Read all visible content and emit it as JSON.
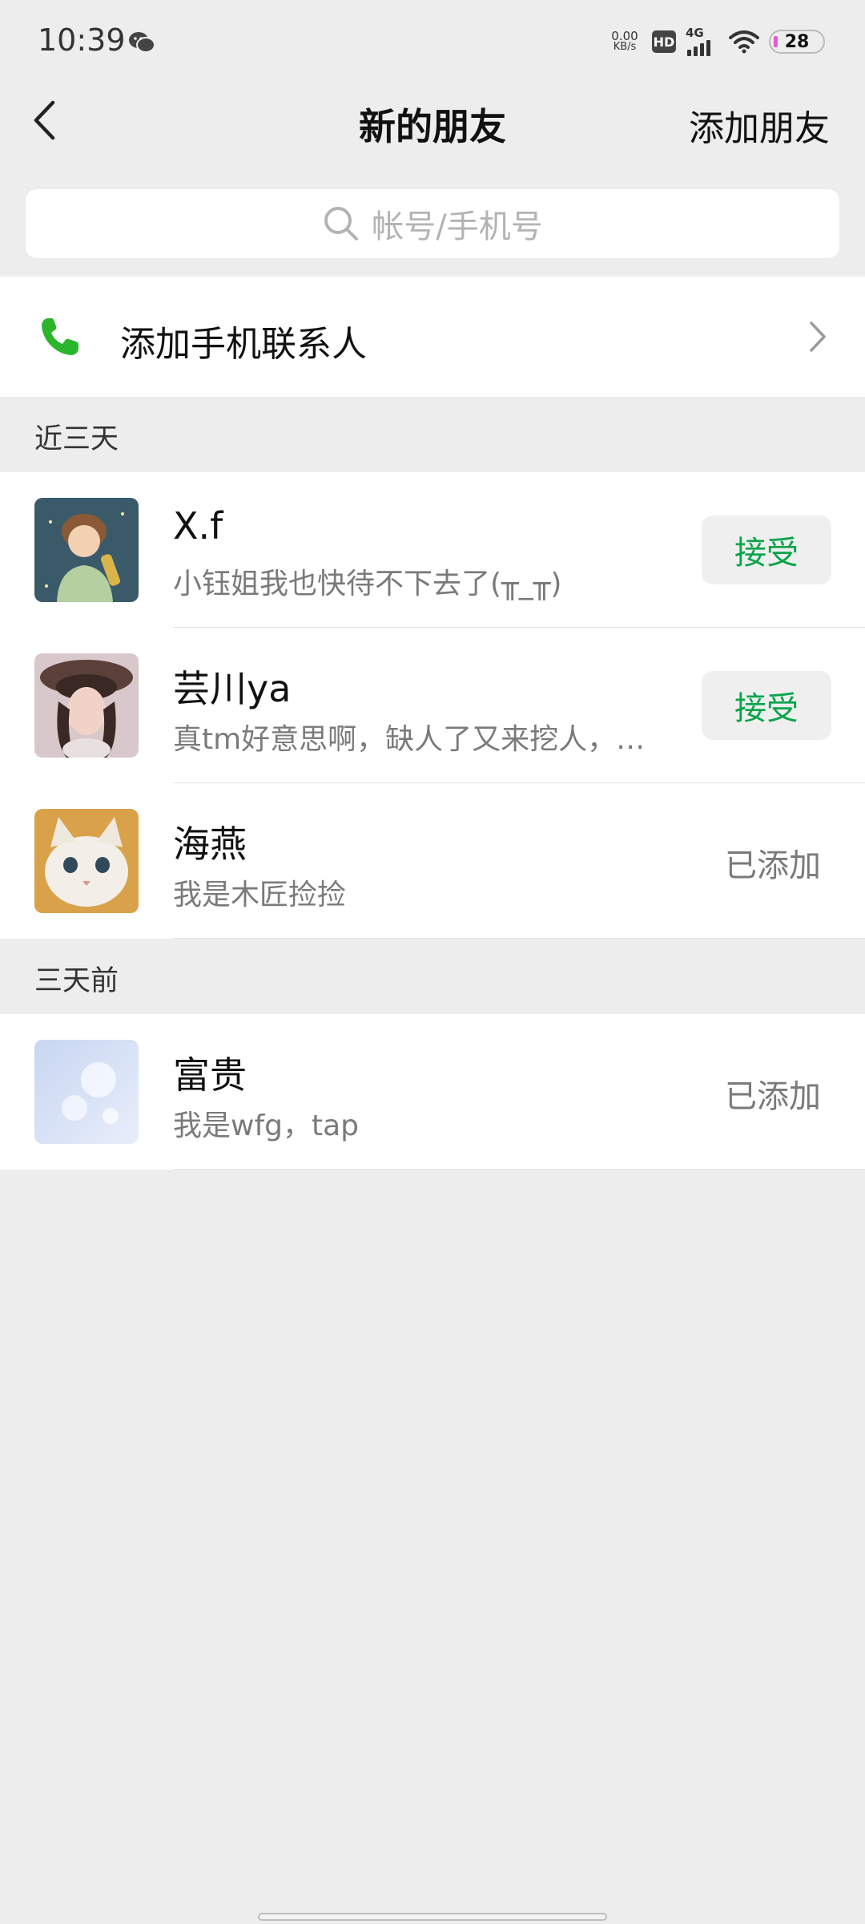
{
  "status_bar": {
    "time": "10:39",
    "net_speed_value": "0.00",
    "net_speed_unit": "KB/s",
    "hd_label": "HD",
    "network_label": "4G",
    "battery_level": "28"
  },
  "nav": {
    "title": "新的朋友",
    "action_label": "添加朋友"
  },
  "search": {
    "placeholder": "帐号/手机号"
  },
  "add_contacts": {
    "label": "添加手机联系人"
  },
  "sections": [
    {
      "title": "近三天",
      "requests": [
        {
          "name": "X.f",
          "message": "小钰姐我也快待不下去了(╥_╥)",
          "status": "接受",
          "status_type": "accept"
        },
        {
          "name": "芸川ya",
          "message": "真tm好意思啊，缺人了又来挖人，…",
          "status": "接受",
          "status_type": "accept"
        },
        {
          "name": "海燕",
          "message": "我是木匠捡捡",
          "status": "已添加",
          "status_type": "added"
        }
      ]
    },
    {
      "title": "三天前",
      "requests": [
        {
          "name": "富贵",
          "message": "我是wfg，tap",
          "status": "已添加",
          "status_type": "added"
        }
      ]
    }
  ],
  "colors": {
    "accent_green": "#07a44a",
    "phone_icon_green": "#2bb52b",
    "background": "#ededed"
  }
}
